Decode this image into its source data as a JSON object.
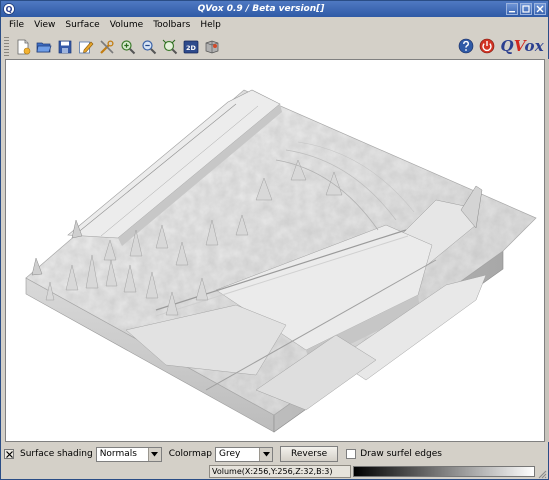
{
  "window": {
    "title": "QVox 0.9 / Beta version[]",
    "app_icon_letter": "Q"
  },
  "menu": [
    {
      "label": "File",
      "name": "menu-file"
    },
    {
      "label": "View",
      "name": "menu-view"
    },
    {
      "label": "Surface",
      "name": "menu-surface"
    },
    {
      "label": "Volume",
      "name": "menu-volume"
    },
    {
      "label": "Toolbars",
      "name": "menu-toolbars"
    },
    {
      "label": "Help",
      "name": "menu-help"
    }
  ],
  "toolbar": {
    "buttons": [
      "new-file-icon",
      "open-folder-icon",
      "save-disk-icon",
      "edit-pencil-icon",
      "tools-icon",
      "zoom-in-icon",
      "zoom-out-icon",
      "zoom-fit-icon",
      "view-2d-icon",
      "snapshot-icon"
    ],
    "label_2d": "2D",
    "logo_q": "Q",
    "logo_v": "V",
    "logo_ox": "ox"
  },
  "controls": {
    "surface_shading_label": "Surface shading",
    "surface_shading_value": "Normals",
    "colormap_label": "Colormap",
    "colormap_value": "Grey",
    "reverse_label": "Reverse",
    "draw_edges_label": "Draw surfel edges",
    "draw_edges_checked": false
  },
  "status": {
    "volume_info": "Volume(X:256,Y:256,Z:32,B:3)"
  },
  "colors": {
    "title_bar": "#3a64ae",
    "viewport_background": "#ffffff",
    "surface": "#dcdcdc",
    "logo_blue": "#2b3f8f",
    "logo_red": "#d2281e"
  }
}
